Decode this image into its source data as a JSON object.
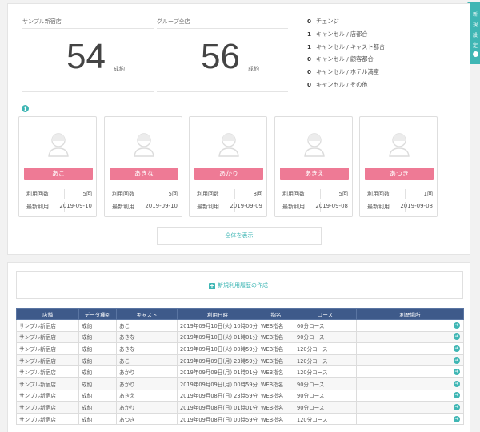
{
  "summary": {
    "shop": {
      "label": "サンプル新宿店",
      "value": "54",
      "unit": "成約"
    },
    "group": {
      "label": "グループ全店",
      "value": "56",
      "unit": "成約"
    }
  },
  "cancellations": [
    {
      "count": "0",
      "label": "チェンジ"
    },
    {
      "count": "1",
      "label": "キャンセル / 店都合"
    },
    {
      "count": "1",
      "label": "キャンセル / キャスト都合"
    },
    {
      "count": "0",
      "label": "キャンセル / 顧客都合"
    },
    {
      "count": "0",
      "label": "キャンセル / ホテル満室"
    },
    {
      "count": "0",
      "label": "キャンセル / その他"
    }
  ],
  "cards": [
    {
      "name": "あこ",
      "count_label": "利用回数",
      "count": "5回",
      "last_label": "最新利用",
      "last": "2019-09-10"
    },
    {
      "name": "あきな",
      "count_label": "利用回数",
      "count": "5回",
      "last_label": "最新利用",
      "last": "2019-09-10"
    },
    {
      "name": "あかり",
      "count_label": "利用回数",
      "count": "8回",
      "last_label": "最新利用",
      "last": "2019-09-09"
    },
    {
      "name": "あきえ",
      "count_label": "利用回数",
      "count": "5回",
      "last_label": "最新利用",
      "last": "2019-09-08"
    },
    {
      "name": "あつき",
      "count_label": "利用回数",
      "count": "1回",
      "last_label": "最新利用",
      "last": "2019-09-08"
    }
  ],
  "show_all_label": "全体を表示",
  "new_entry_label": "新規利用履歴の作成",
  "table": {
    "headers": [
      "店舗",
      "データ種別",
      "キャスト",
      "利用日時",
      "指名",
      "コース",
      "利歴場所"
    ],
    "rows": [
      [
        "サンプル新宿店",
        "成約",
        "あこ",
        "2019年09月10日(火) 10時00分",
        "WEB指名",
        "60分コース"
      ],
      [
        "サンプル新宿店",
        "成約",
        "あきな",
        "2019年09月10日(火) 01時01分",
        "WEB指名",
        "90分コース"
      ],
      [
        "サンプル新宿店",
        "成約",
        "あきな",
        "2019年09月10日(火) 00時59分",
        "WEB指名",
        "120分コース"
      ],
      [
        "サンプル新宿店",
        "成約",
        "あこ",
        "2019年09月09日(月) 23時59分",
        "WEB指名",
        "120分コース"
      ],
      [
        "サンプル新宿店",
        "成約",
        "あかり",
        "2019年09月09日(月) 01時01分",
        "WEB指名",
        "120分コース"
      ],
      [
        "サンプル新宿店",
        "成約",
        "あかり",
        "2019年09月09日(月) 00時59分",
        "WEB指名",
        "90分コース"
      ],
      [
        "サンプル新宿店",
        "成約",
        "あきえ",
        "2019年09月08日(日) 23時59分",
        "WEB指名",
        "90分コース"
      ],
      [
        "サンプル新宿店",
        "成約",
        "あかり",
        "2019年09月08日(日) 01時01分",
        "WEB指名",
        "90分コース"
      ],
      [
        "サンプル新宿店",
        "成約",
        "あつき",
        "2019年09月08日(日) 00時59分",
        "WEB指名",
        "120分コース"
      ]
    ]
  },
  "side_tab_text": "新規設定",
  "colors": {
    "accent": "#3fb6b4",
    "card_button": "#ee7a95",
    "table_header": "#3e5a8a"
  }
}
